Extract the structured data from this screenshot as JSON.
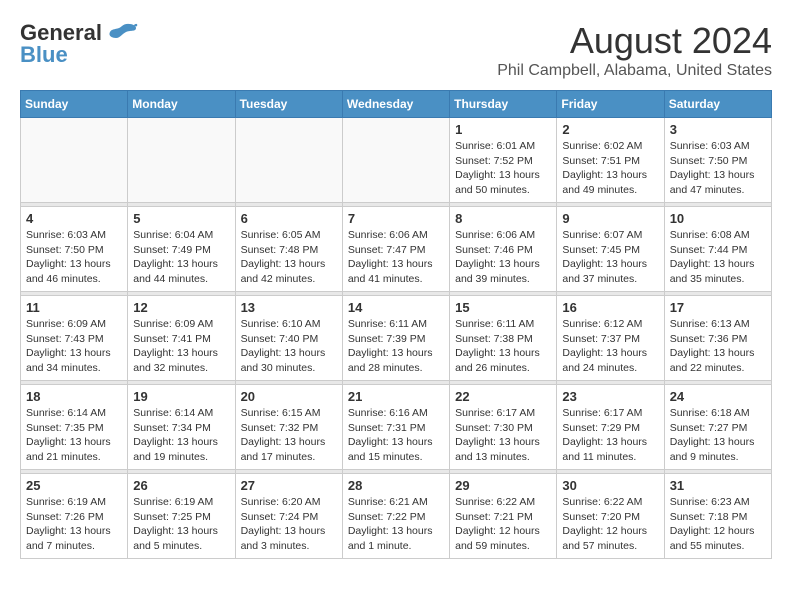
{
  "logo": {
    "line1": "General",
    "line2": "Blue"
  },
  "title": "August 2024",
  "subtitle": "Phil Campbell, Alabama, United States",
  "days_of_week": [
    "Sunday",
    "Monday",
    "Tuesday",
    "Wednesday",
    "Thursday",
    "Friday",
    "Saturday"
  ],
  "weeks": [
    {
      "days": [
        {
          "number": "",
          "detail": ""
        },
        {
          "number": "",
          "detail": ""
        },
        {
          "number": "",
          "detail": ""
        },
        {
          "number": "",
          "detail": ""
        },
        {
          "number": "1",
          "detail": "Sunrise: 6:01 AM\nSunset: 7:52 PM\nDaylight: 13 hours\nand 50 minutes."
        },
        {
          "number": "2",
          "detail": "Sunrise: 6:02 AM\nSunset: 7:51 PM\nDaylight: 13 hours\nand 49 minutes."
        },
        {
          "number": "3",
          "detail": "Sunrise: 6:03 AM\nSunset: 7:50 PM\nDaylight: 13 hours\nand 47 minutes."
        }
      ]
    },
    {
      "days": [
        {
          "number": "4",
          "detail": "Sunrise: 6:03 AM\nSunset: 7:50 PM\nDaylight: 13 hours\nand 46 minutes."
        },
        {
          "number": "5",
          "detail": "Sunrise: 6:04 AM\nSunset: 7:49 PM\nDaylight: 13 hours\nand 44 minutes."
        },
        {
          "number": "6",
          "detail": "Sunrise: 6:05 AM\nSunset: 7:48 PM\nDaylight: 13 hours\nand 42 minutes."
        },
        {
          "number": "7",
          "detail": "Sunrise: 6:06 AM\nSunset: 7:47 PM\nDaylight: 13 hours\nand 41 minutes."
        },
        {
          "number": "8",
          "detail": "Sunrise: 6:06 AM\nSunset: 7:46 PM\nDaylight: 13 hours\nand 39 minutes."
        },
        {
          "number": "9",
          "detail": "Sunrise: 6:07 AM\nSunset: 7:45 PM\nDaylight: 13 hours\nand 37 minutes."
        },
        {
          "number": "10",
          "detail": "Sunrise: 6:08 AM\nSunset: 7:44 PM\nDaylight: 13 hours\nand 35 minutes."
        }
      ]
    },
    {
      "days": [
        {
          "number": "11",
          "detail": "Sunrise: 6:09 AM\nSunset: 7:43 PM\nDaylight: 13 hours\nand 34 minutes."
        },
        {
          "number": "12",
          "detail": "Sunrise: 6:09 AM\nSunset: 7:41 PM\nDaylight: 13 hours\nand 32 minutes."
        },
        {
          "number": "13",
          "detail": "Sunrise: 6:10 AM\nSunset: 7:40 PM\nDaylight: 13 hours\nand 30 minutes."
        },
        {
          "number": "14",
          "detail": "Sunrise: 6:11 AM\nSunset: 7:39 PM\nDaylight: 13 hours\nand 28 minutes."
        },
        {
          "number": "15",
          "detail": "Sunrise: 6:11 AM\nSunset: 7:38 PM\nDaylight: 13 hours\nand 26 minutes."
        },
        {
          "number": "16",
          "detail": "Sunrise: 6:12 AM\nSunset: 7:37 PM\nDaylight: 13 hours\nand 24 minutes."
        },
        {
          "number": "17",
          "detail": "Sunrise: 6:13 AM\nSunset: 7:36 PM\nDaylight: 13 hours\nand 22 minutes."
        }
      ]
    },
    {
      "days": [
        {
          "number": "18",
          "detail": "Sunrise: 6:14 AM\nSunset: 7:35 PM\nDaylight: 13 hours\nand 21 minutes."
        },
        {
          "number": "19",
          "detail": "Sunrise: 6:14 AM\nSunset: 7:34 PM\nDaylight: 13 hours\nand 19 minutes."
        },
        {
          "number": "20",
          "detail": "Sunrise: 6:15 AM\nSunset: 7:32 PM\nDaylight: 13 hours\nand 17 minutes."
        },
        {
          "number": "21",
          "detail": "Sunrise: 6:16 AM\nSunset: 7:31 PM\nDaylight: 13 hours\nand 15 minutes."
        },
        {
          "number": "22",
          "detail": "Sunrise: 6:17 AM\nSunset: 7:30 PM\nDaylight: 13 hours\nand 13 minutes."
        },
        {
          "number": "23",
          "detail": "Sunrise: 6:17 AM\nSunset: 7:29 PM\nDaylight: 13 hours\nand 11 minutes."
        },
        {
          "number": "24",
          "detail": "Sunrise: 6:18 AM\nSunset: 7:27 PM\nDaylight: 13 hours\nand 9 minutes."
        }
      ]
    },
    {
      "days": [
        {
          "number": "25",
          "detail": "Sunrise: 6:19 AM\nSunset: 7:26 PM\nDaylight: 13 hours\nand 7 minutes."
        },
        {
          "number": "26",
          "detail": "Sunrise: 6:19 AM\nSunset: 7:25 PM\nDaylight: 13 hours\nand 5 minutes."
        },
        {
          "number": "27",
          "detail": "Sunrise: 6:20 AM\nSunset: 7:24 PM\nDaylight: 13 hours\nand 3 minutes."
        },
        {
          "number": "28",
          "detail": "Sunrise: 6:21 AM\nSunset: 7:22 PM\nDaylight: 13 hours\nand 1 minute."
        },
        {
          "number": "29",
          "detail": "Sunrise: 6:22 AM\nSunset: 7:21 PM\nDaylight: 12 hours\nand 59 minutes."
        },
        {
          "number": "30",
          "detail": "Sunrise: 6:22 AM\nSunset: 7:20 PM\nDaylight: 12 hours\nand 57 minutes."
        },
        {
          "number": "31",
          "detail": "Sunrise: 6:23 AM\nSunset: 7:18 PM\nDaylight: 12 hours\nand 55 minutes."
        }
      ]
    }
  ]
}
